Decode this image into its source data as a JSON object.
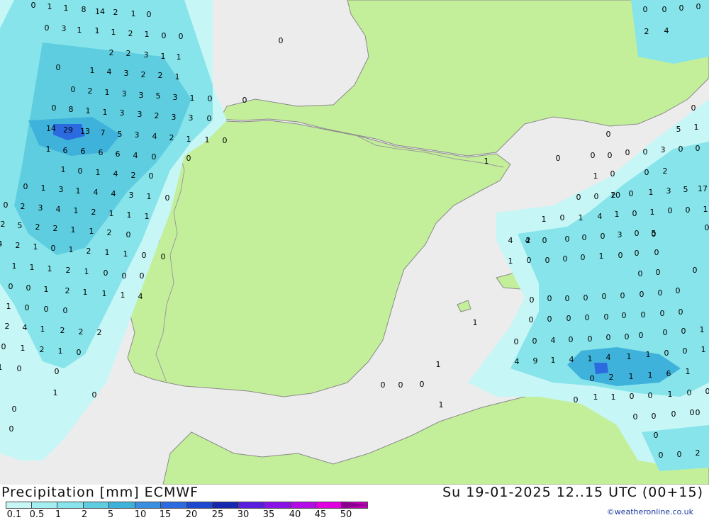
{
  "map": {
    "colors": {
      "sea": "#ececec",
      "land": "#c4ef9a",
      "border": "#9a9a9a",
      "coast": "#8a8a8a"
    },
    "values": [
      "0",
      "1",
      "1",
      "8",
      "14",
      "2",
      "1",
      "0",
      "0",
      "3",
      "1",
      "1",
      "1",
      "2",
      "1",
      "0",
      "0",
      "0",
      "2",
      "2",
      "3",
      "1",
      "1",
      "0",
      "1",
      "4",
      "3",
      "2",
      "2",
      "1",
      "0",
      "2",
      "1",
      "3",
      "3",
      "5",
      "3",
      "1",
      "0",
      "0",
      "0",
      "8",
      "1",
      "1",
      "3",
      "3",
      "2",
      "3",
      "3",
      "0",
      "14",
      "29",
      "13",
      "7",
      "5",
      "3",
      "4",
      "2",
      "1",
      "1",
      "0",
      "1",
      "6",
      "6",
      "6",
      "6",
      "4",
      "0",
      "0",
      "1",
      "0",
      "1",
      "4",
      "2",
      "0",
      "0",
      "1",
      "3",
      "1",
      "4",
      "4",
      "3",
      "1",
      "0",
      "0",
      "2",
      "3",
      "4",
      "1",
      "2",
      "1",
      "1",
      "1",
      "2",
      "5",
      "2",
      "2",
      "1",
      "1",
      "2",
      "0",
      "4",
      "2",
      "1",
      "0",
      "1",
      "2",
      "1",
      "1",
      "0",
      "0",
      "1",
      "1",
      "1",
      "2",
      "1",
      "0",
      "0",
      "0",
      "1",
      "2",
      "1",
      "1",
      "1",
      "4",
      "0",
      "0",
      "1",
      "0",
      "0",
      "0",
      "2",
      "4",
      "1",
      "2",
      "2",
      "2",
      "0",
      "1",
      "2",
      "1",
      "0",
      "1",
      "0",
      "0",
      "0",
      "1",
      "0",
      "0",
      "1",
      "0",
      "0",
      "0",
      "1",
      "1",
      "1",
      "2",
      "0",
      "0",
      "0",
      "0",
      "0",
      "0",
      "5",
      "1",
      "0",
      "0",
      "0",
      "0",
      "0",
      "2",
      "4",
      "0",
      "3",
      "0",
      "0",
      "1",
      "2",
      "0",
      "10",
      "1",
      "3",
      "5",
      "17",
      "0",
      "0",
      "0",
      "2",
      "1",
      "0",
      "1",
      "4",
      "1",
      "0",
      "1",
      "0",
      "0",
      "1",
      "0",
      "5",
      "0",
      "4",
      "4",
      "0",
      "0",
      "0",
      "0",
      "3",
      "0",
      "0",
      "0",
      "1",
      "0",
      "0",
      "0",
      "0",
      "1",
      "0",
      "0",
      "0",
      "0",
      "0",
      "0",
      "0",
      "0",
      "0",
      "0",
      "0",
      "0",
      "0",
      "0",
      "0",
      "0",
      "0",
      "0",
      "0",
      "0",
      "0",
      "0",
      "0",
      "0",
      "1",
      "0",
      "0",
      "0",
      "4",
      "0",
      "0",
      "0",
      "0",
      "0",
      "1",
      "4",
      "9",
      "1",
      "4",
      "1",
      "4",
      "1",
      "1",
      "0",
      "0",
      "2",
      "1",
      "1",
      "6",
      "1",
      "1",
      "0",
      "0",
      "1",
      "0",
      "0",
      "0",
      "0",
      "0",
      "0",
      "0",
      "0",
      "1",
      "0",
      "0",
      "0",
      "2",
      "3",
      "0"
    ]
  },
  "footer": {
    "title": "Precipitation [mm] ECMWF",
    "datetime": "Su 19-01-2025 12..15 UTC (00+15)",
    "credit": "©weatheronline.co.uk",
    "legend_labels": [
      "0.1",
      "0.5",
      "1",
      "2",
      "5",
      "10",
      "15",
      "20",
      "25",
      "30",
      "35",
      "40",
      "45",
      "50"
    ],
    "legend_colors": [
      "#c6f6f6",
      "#a4eef0",
      "#86e4ea",
      "#5ecde0",
      "#3fb2dc",
      "#3a8fe0",
      "#2c6ae0",
      "#1f48d0",
      "#1628b0",
      "#5a1ee0",
      "#8a14e8",
      "#b40ce8",
      "#e000e0",
      "#c000b8"
    ]
  }
}
